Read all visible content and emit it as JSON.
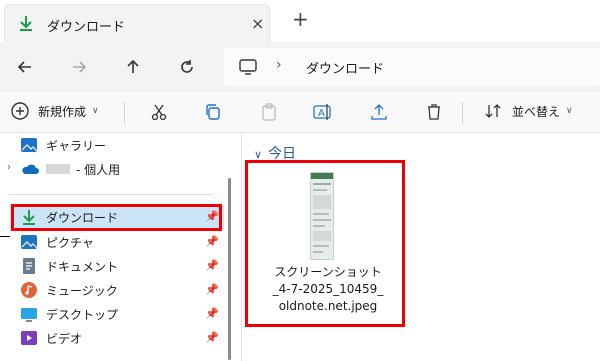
{
  "tab": {
    "title": "ダウンロード",
    "close": "×",
    "add": "+"
  },
  "address": {
    "path": "ダウンロード",
    "separator": "›"
  },
  "toolbar": {
    "new_label": "新規作成",
    "sort_label": "並べ替え"
  },
  "sidebar": {
    "items": [
      {
        "label": "ギャラリー"
      },
      {
        "label": "- 個人用"
      },
      {
        "label": "ダウンロード",
        "selected": true
      },
      {
        "label": "ピクチャ"
      },
      {
        "label": "ドキュメント"
      },
      {
        "label": "ミュージック"
      },
      {
        "label": "デスクトップ"
      },
      {
        "label": "ビデオ"
      }
    ]
  },
  "content": {
    "group": "今日",
    "file_line1": "スクリーンショット",
    "file_line2": "_4-7-2025_10459_",
    "file_line3": "oldnote.net.jpeg"
  },
  "colors": {
    "accent": "#0f6cbd",
    "highlight": "#e00000",
    "selection": "#cce4f7"
  }
}
